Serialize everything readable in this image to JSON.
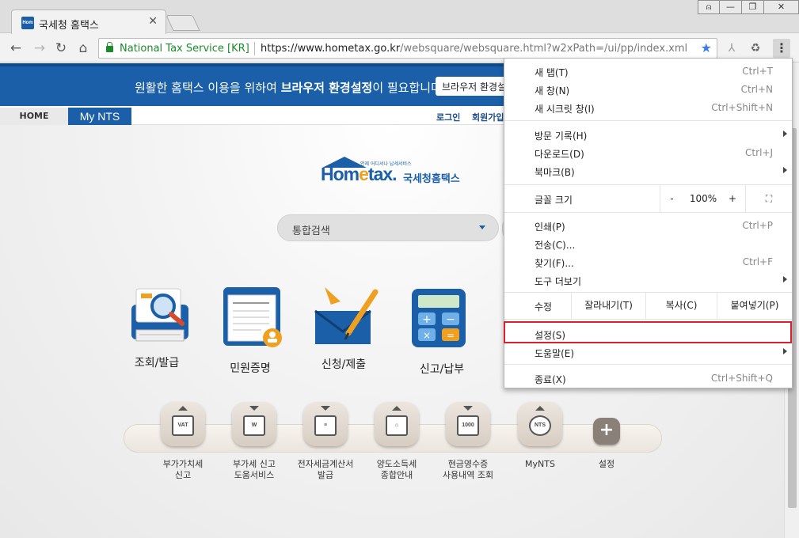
{
  "browser": {
    "tab_title": "국세청 홈택스",
    "tab_favicon": "Hom",
    "tab_close": "✕",
    "site_identity": "National Tax Service [KR]",
    "url_host": "https://www.hometax.go.kr",
    "url_path": "/websquare/websquare.html?w2xPath=/ui/pp/index.xml",
    "window_buttons": [
      "⍝",
      "—",
      "❐",
      "✕"
    ]
  },
  "notice": {
    "text_plain": "원활한 홈택스 이용을 위하여 ",
    "text_bold": "브라우저 환경설정",
    "text_end": "이 필요합니다.",
    "button": "브라우저 환경설정"
  },
  "gnb": {
    "home": "HOME",
    "mynts": "My NTS",
    "login": "로그인",
    "join": "회원가입"
  },
  "logo": {
    "en_prefix": "Hom",
    "en_e": "e",
    "en_suffix": "tax.",
    "small": "언제 어디서나 납세서비스",
    "ko": "국세청홈택스"
  },
  "search": {
    "label": "통합검색"
  },
  "main_menu": [
    {
      "label": "조회/발급",
      "icon": "document-search-icon"
    },
    {
      "label": "민원증명",
      "icon": "certificate-icon"
    },
    {
      "label": "신청/제출",
      "icon": "envelope-pen-icon"
    },
    {
      "label": "신고/납부",
      "icon": "calculator-icon"
    }
  ],
  "quick_menu": [
    {
      "label": "부가가치세\n신고",
      "glyph": "VAT",
      "arrow": "up"
    },
    {
      "label": "부가세 신고\n도움서비스",
      "glyph": "W",
      "arrow": "down"
    },
    {
      "label": "전자세금계산서\n발급",
      "glyph": "≡",
      "arrow": "down"
    },
    {
      "label": "양도소득세\n종합안내",
      "glyph": "⌂",
      "arrow": "up"
    },
    {
      "label": "현금영수증\n사용내역 조회",
      "glyph": "1000",
      "arrow": "down"
    },
    {
      "label": "MyNTS",
      "glyph": "NTS",
      "arrow": "up"
    },
    {
      "label": "설정",
      "glyph": "+",
      "arrow": "none"
    }
  ],
  "chrome_menu": {
    "items": [
      {
        "label": "새 탭(T)",
        "shortcut": "Ctrl+T"
      },
      {
        "label": "새 창(N)",
        "shortcut": "Ctrl+N"
      },
      {
        "label": "새 시크릿 창(I)",
        "shortcut": "Ctrl+Shift+N"
      },
      {
        "label": "방문 기록(H)",
        "shortcut": ""
      },
      {
        "label": "다운로드(D)",
        "shortcut": "Ctrl+J"
      },
      {
        "label": "북마크(B)",
        "shortcut": ""
      },
      {
        "label": "인쇄(P)",
        "shortcut": "Ctrl+P"
      },
      {
        "label": "전송(C)...",
        "shortcut": ""
      },
      {
        "label": "찾기(F)...",
        "shortcut": "Ctrl+F"
      },
      {
        "label": "도구 더보기",
        "shortcut": ""
      },
      {
        "label": "설정(S)",
        "shortcut": ""
      },
      {
        "label": "도움말(E)",
        "shortcut": ""
      },
      {
        "label": "종료(X)",
        "shortcut": "Ctrl+Shift+Q"
      }
    ],
    "zoom": {
      "label": "글꼴 크기",
      "minus": "-",
      "value": "100%",
      "plus": "+",
      "fullscreen": "⛶"
    },
    "edit": {
      "label": "수정",
      "cut": "잘라내기(T)",
      "copy": "복사(C)",
      "paste": "붙여넣기(P)"
    }
  },
  "colors": {
    "accent": "#1a5fa7",
    "highlight": "#d9202c"
  }
}
